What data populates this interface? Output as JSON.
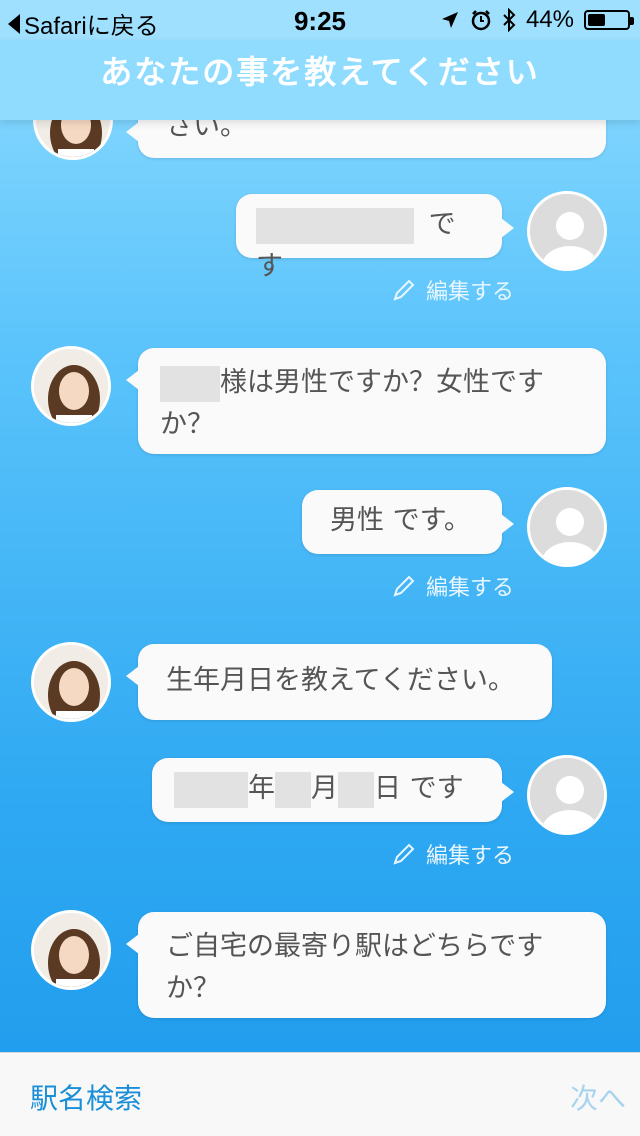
{
  "status_bar": {
    "back_label": "Safariに戻る",
    "time": "9:25",
    "battery_text": "44%",
    "battery_level": 0.44,
    "icons": [
      "location-arrow-icon",
      "alarm-icon",
      "bluetooth-icon",
      "battery-icon"
    ]
  },
  "title": "あなたの事を教えてください",
  "messages": {
    "m0_text": "さい。",
    "m1_suffix": "です",
    "m2_suffix": "様は男性ですか？女性ですか？",
    "m3_text": "男性 です。",
    "m4_text": "生年月日を教えてください。",
    "m5_year": "年",
    "m5_month": "月",
    "m5_day": "日",
    "m5_suffix": " です",
    "m6_text": "ご自宅の最寄り駅はどちらですか？"
  },
  "edit_label": "編集する",
  "bottom_bar": {
    "station_search": "駅名検索",
    "next": "次へ"
  },
  "colors": {
    "accent": "#1a8fd8",
    "header": "#8fdcff",
    "bubble": "#fafafa"
  }
}
